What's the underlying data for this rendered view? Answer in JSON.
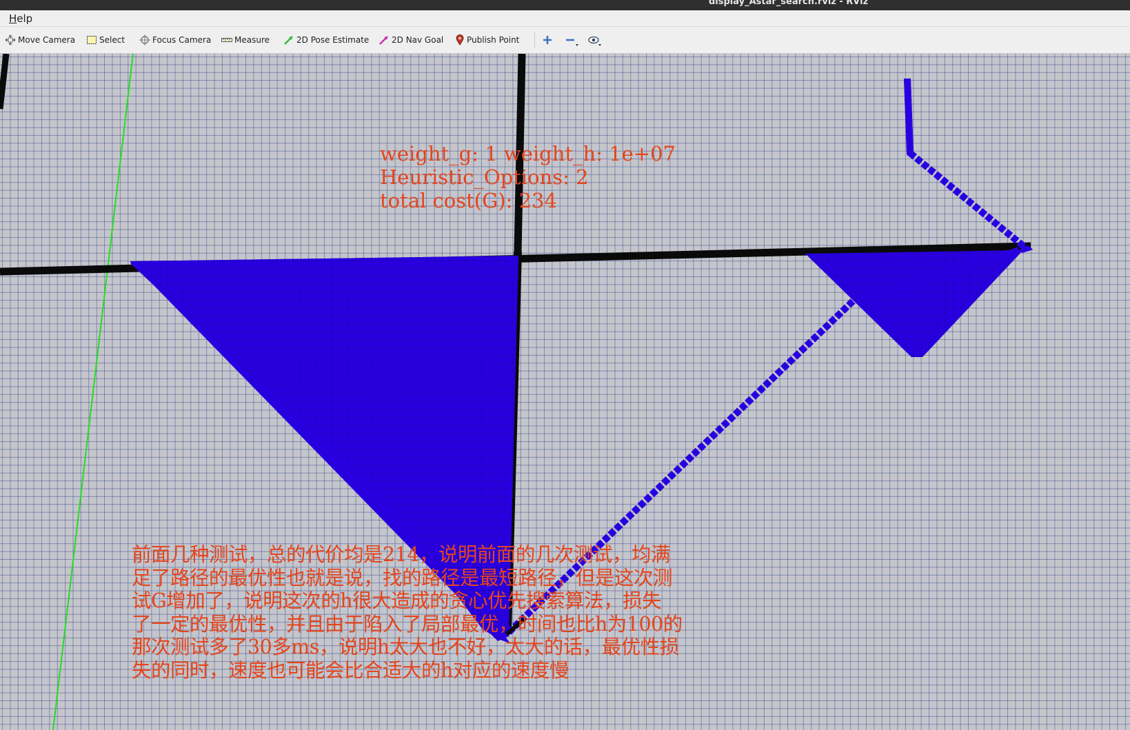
{
  "window": {
    "title": "display_Astar_search.rviz - RViz"
  },
  "menu": {
    "items": [
      "Help"
    ]
  },
  "toolbar": {
    "tools": [
      {
        "label": "Move Camera",
        "icon": "move-camera-icon"
      },
      {
        "label": "Select",
        "icon": "select-icon"
      },
      {
        "label": "Focus Camera",
        "icon": "focus-camera-icon"
      },
      {
        "label": "Measure",
        "icon": "measure-icon"
      },
      {
        "label": "2D Pose Estimate",
        "icon": "pose-estimate-icon"
      },
      {
        "label": "2D Nav Goal",
        "icon": "nav-goal-icon"
      },
      {
        "label": "Publish Point",
        "icon": "publish-point-icon"
      }
    ],
    "icon_buttons": [
      "add-tool-icon",
      "remove-tool-icon",
      "view-icon"
    ]
  },
  "overlay": {
    "info_lines": [
      "weight_g: 1 weight_h: 1e+07",
      "Heuristic_Options: 2",
      "total cost(G): 234"
    ],
    "note_lines": [
      "前面几种测试，总的代价均是214，说明前面的几次测试，均满",
      "足了路径的最优性也就是说，找的路径是最短路径，但是这次测",
      "试G增加了，说明这次的h很大造成的贪心优先搜索算法，损失",
      "了一定的最优性，并且由于陷入了局部最优，时间也比h为100的",
      "那次测试多了30多ms，说明h太大也不好，太大的话，最优性损",
      "失的同时，速度也可能会比合适大的h对应的速度慢"
    ]
  },
  "colors": {
    "grid_background": "#c5c6cb",
    "explored_cells": "#2800e0",
    "obstacle": "#0a0a0a",
    "path": "#2800e0",
    "axis_line": "#22dd22",
    "overlay_text": "#e4451c"
  }
}
